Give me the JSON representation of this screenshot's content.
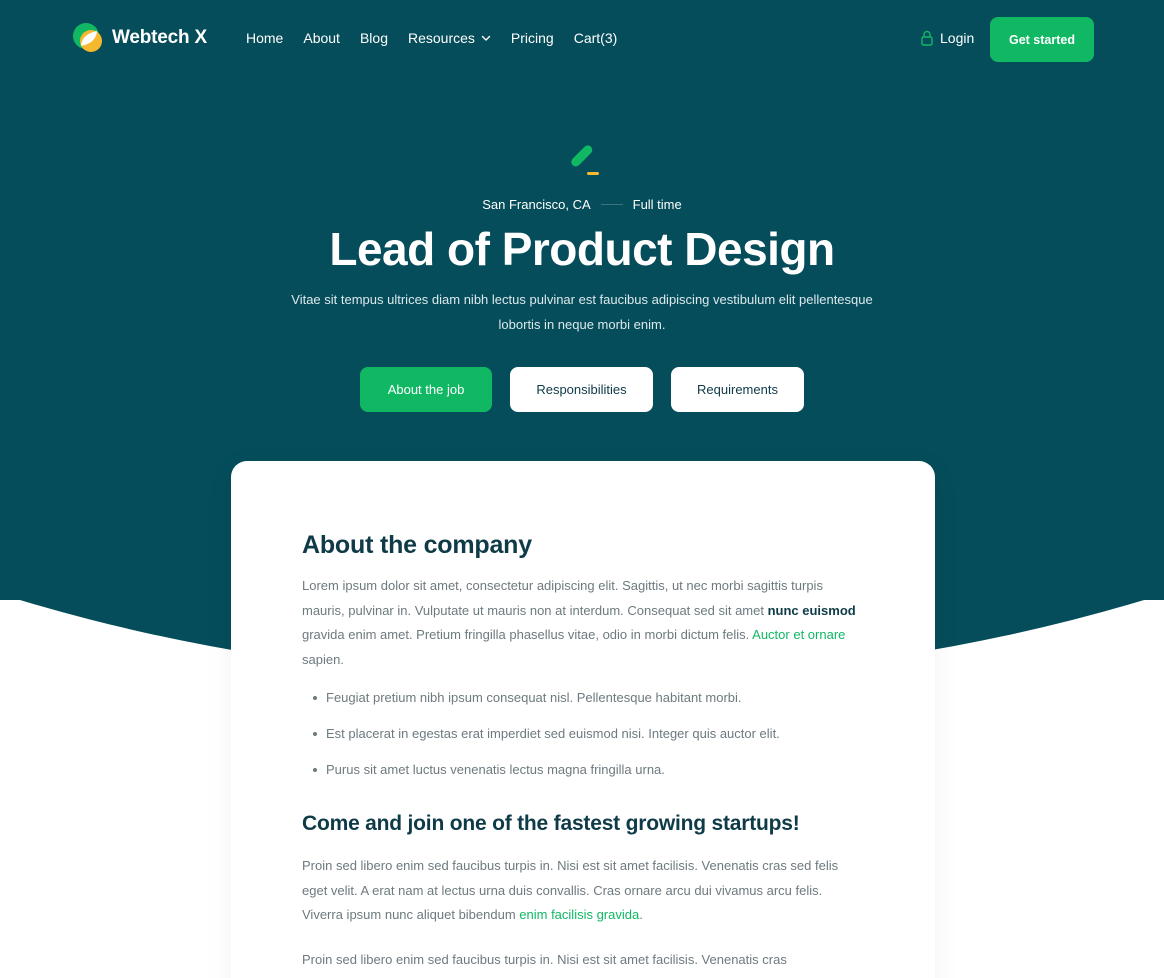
{
  "brand": {
    "name": "Webtech X",
    "accent": "#11b864",
    "dark": "#054d5a",
    "logo_secondary": "#f5b82e"
  },
  "nav": {
    "links": [
      {
        "label": "Home"
      },
      {
        "label": "About"
      },
      {
        "label": "Blog"
      },
      {
        "label": "Resources",
        "icon": "chevron-down-icon"
      },
      {
        "label": "Pricing"
      },
      {
        "label": "Cart(3)"
      }
    ],
    "login_label": "Login",
    "cta_label": "Get started"
  },
  "hero": {
    "icon": "pencil-icon",
    "location": "San Francisco, CA",
    "type": "Full time",
    "title": "Lead of Product Design",
    "subtitle": "Vitae sit tempus ultrices diam nibh lectus pulvinar est faucibus adipiscing vestibulum elit pellentesque lobortis in neque morbi enim.",
    "tabs": [
      {
        "label": "About the job",
        "active": true
      },
      {
        "label": "Responsibilities",
        "active": false
      },
      {
        "label": "Requirements",
        "active": false
      }
    ]
  },
  "content": {
    "about_title": "About the company",
    "about_para": {
      "part1": "Lorem ipsum dolor sit amet, consectetur adipiscing elit. Sagittis, ut nec morbi sagittis turpis mauris, pulvinar in. Vulputate ut mauris non at interdum. Consequat sed sit amet ",
      "bold": "nunc euismod",
      "part2": " gravida enim amet. Pretium fringilla phasellus vitae, odio in morbi dictum felis. ",
      "link": "Auctor et ornare",
      "part3": " sapien."
    },
    "bullets": [
      "Feugiat pretium nibh ipsum consequat nisl. Pellentesque habitant morbi.",
      "Est placerat in egestas erat imperdiet sed euismod nisi. Integer quis auctor elit.",
      "Purus sit amet luctus venenatis lectus magna fringilla urna."
    ],
    "join_title": "Come and join one of the fastest growing startups!",
    "join_para": {
      "part1": "Proin sed libero enim sed faucibus turpis in. Nisi est sit amet facilisis. Venenatis cras sed felis eget velit. A erat nam at lectus urna duis convallis. Cras ornare arcu dui vivamus arcu felis. Viverra ipsum nunc aliquet bibendum ",
      "link": "enim facilisis gravida",
      "part2": "."
    },
    "para3": "Proin sed libero enim sed faucibus turpis in. Nisi est sit amet facilisis. Venenatis cras"
  }
}
